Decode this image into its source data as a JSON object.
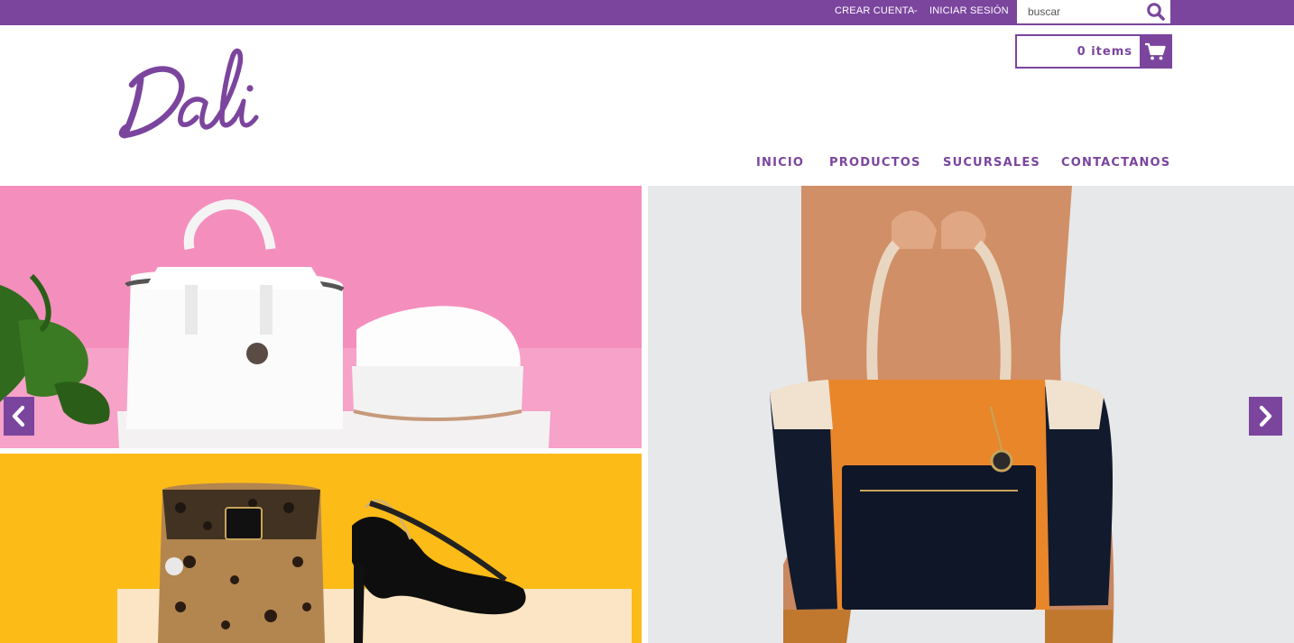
{
  "header": {
    "create_account": "CREAR CUENTA",
    "separator": "-",
    "login": "INICIAR SESIÓN",
    "search": {
      "placeholder": "buscar",
      "icon": "search-icon"
    },
    "cart": {
      "label": "0 items",
      "icon": "cart-icon"
    }
  },
  "logo": {
    "text": "Dali"
  },
  "nav": {
    "items": [
      {
        "label": "INICIO"
      },
      {
        "label": "PRODUCTOS"
      },
      {
        "label": "SUCURSALES"
      },
      {
        "label": "CONTACTANOS"
      }
    ]
  },
  "slider": {
    "prev_icon": "chevron-left-icon",
    "next_icon": "chevron-right-icon"
  },
  "colors": {
    "brand": "#7b459e",
    "pink_bg": "#f48fbd",
    "yellow_bg": "#fdbb17",
    "gray_bg": "#e4e6e8"
  }
}
